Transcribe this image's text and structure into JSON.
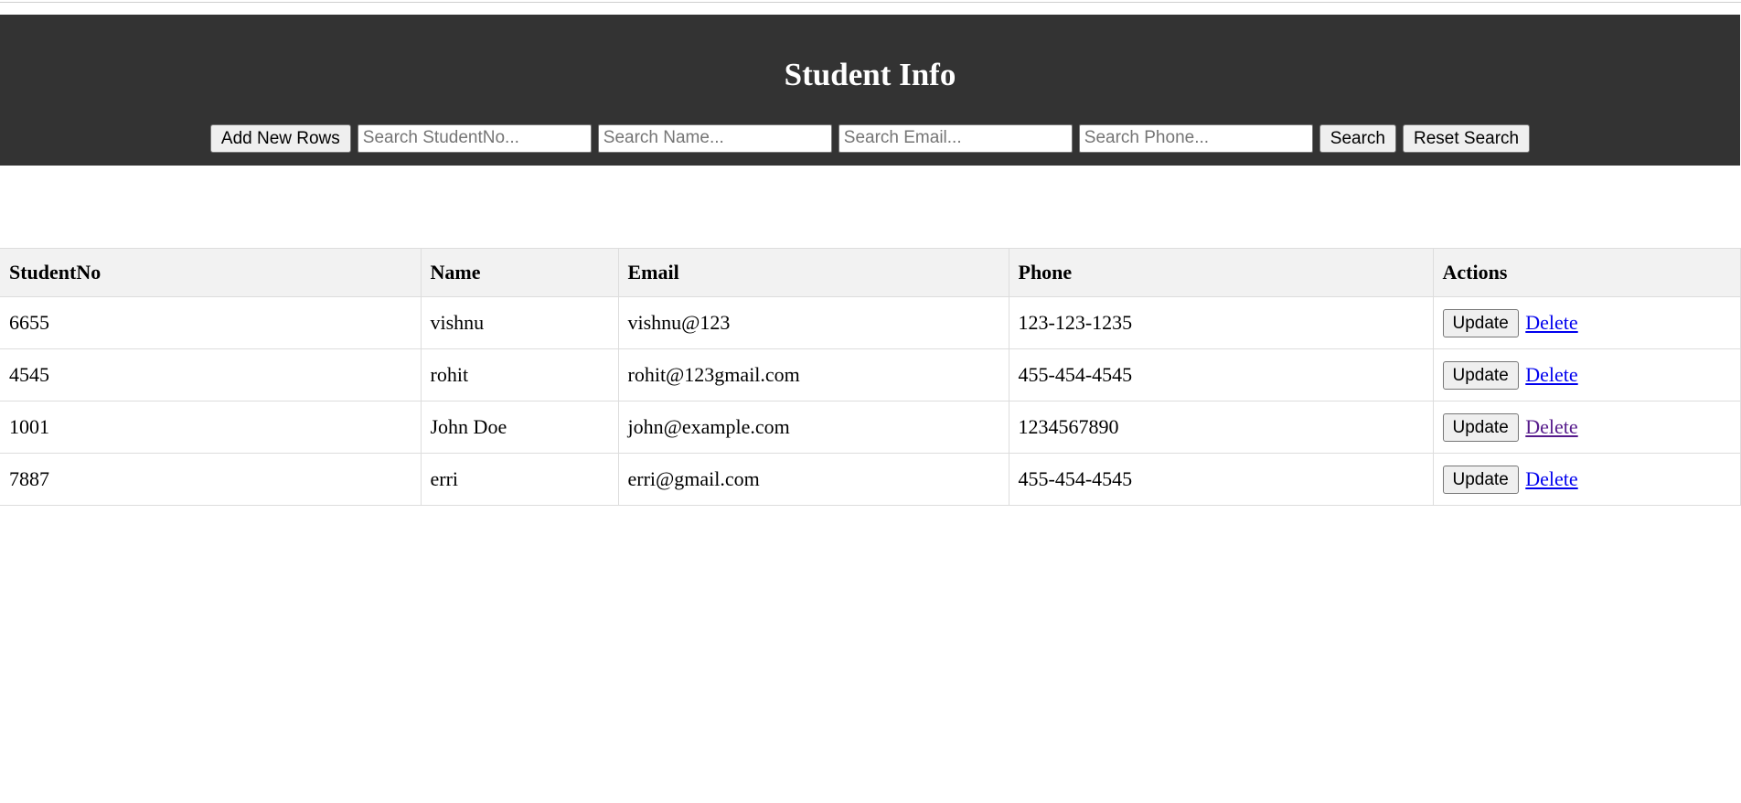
{
  "header": {
    "title": "Student Info",
    "background_color": "#333333",
    "add_button_label": "Add New Rows",
    "search_studentno_placeholder": "Search StudentNo...",
    "search_name_placeholder": "Search Name...",
    "search_email_placeholder": "Search Email...",
    "search_phone_placeholder": "Search Phone...",
    "search_button_label": "Search",
    "reset_button_label": "Reset Search"
  },
  "table": {
    "columns": [
      "StudentNo",
      "Name",
      "Email",
      "Phone",
      "Actions"
    ],
    "rows": [
      {
        "student_no": "6655",
        "name": "vishnu",
        "email": "vishnu@123",
        "phone": "123-123-1235",
        "update_label": "Update",
        "delete_label": "Delete"
      },
      {
        "student_no": "4545",
        "name": "rohit",
        "email": "rohit@123gmail.com",
        "phone": "455-454-4545",
        "update_label": "Update",
        "delete_label": "Delete"
      },
      {
        "student_no": "1001",
        "name": "John Doe",
        "email": "john@example.com",
        "phone": "1234567890",
        "update_label": "Update",
        "delete_label": "Delete"
      },
      {
        "student_no": "7887",
        "name": "erri",
        "email": "erri@gmail.com",
        "phone": "455-454-4545",
        "update_label": "Update",
        "delete_label": "Delete"
      }
    ]
  },
  "colors": {
    "link": "#0000ee",
    "visited_link": "#551a8b",
    "table_header_bg": "#f2f2f2"
  }
}
